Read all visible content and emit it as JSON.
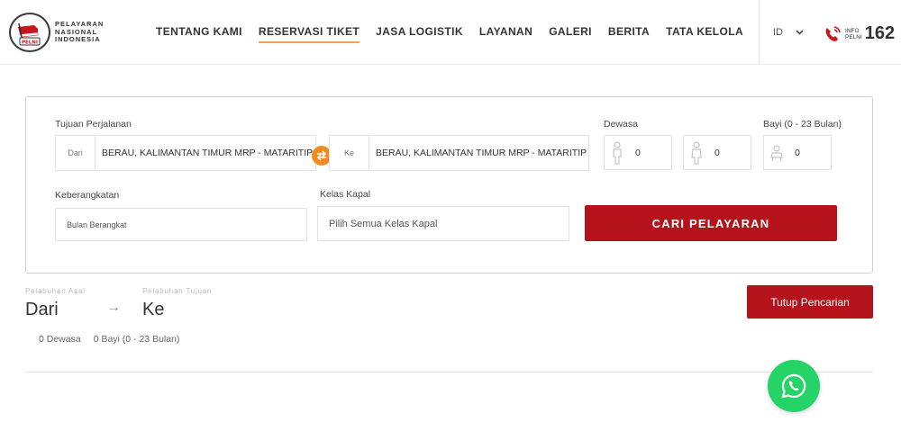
{
  "brand": {
    "lines": [
      "PELAYARAN",
      "NASIONAL",
      "INDONESIA"
    ],
    "badge_text": "PELNI"
  },
  "nav": [
    {
      "label": "TENTANG KAMI",
      "active": false
    },
    {
      "label": "RESERVASI TIKET",
      "active": true
    },
    {
      "label": "JASA LOGISTIK",
      "active": false
    },
    {
      "label": "LAYANAN",
      "active": false
    },
    {
      "label": "GALERI",
      "active": false
    },
    {
      "label": "BERITA",
      "active": false
    },
    {
      "label": "TATA KELOLA",
      "active": false
    }
  ],
  "header_right": {
    "language": "ID",
    "info_label_top": "INFO",
    "info_label_bottom": "PELNI",
    "info_number": "162"
  },
  "search": {
    "destination_label": "Tujuan Perjalanan",
    "from_prefix": "Dari",
    "from_value": "BERAU, KALIMANTAN TIMUR MRP - MATARITIP",
    "to_prefix": "Ke",
    "to_value": "BERAU, KALIMANTAN TIMUR MRP - MATARITIP",
    "adult_label": "Dewasa",
    "adult_value": "0",
    "second_pax_value": "0",
    "infant_label": "Bayi (0 - 23 Bulan)",
    "infant_value": "0",
    "departure_label": "Keberangkatan",
    "departure_placeholder": "Bulan Berangkat",
    "class_label": "Kelas Kapal",
    "class_placeholder": "Pilih Semua Kelas Kapal",
    "search_button": "CARI PELAYARAN"
  },
  "summary": {
    "origin_label": "Pelabuhan Asal",
    "origin_value": "Dari",
    "destination_label": "Pelabuhan Tujuan",
    "destination_value": "Ke",
    "arrow": "→",
    "adults": "0 Dewasa",
    "infants": "0 Bayi (0 - 23 Bulan)",
    "close_button": "Tutup Pencarian"
  },
  "colors": {
    "primary": "#b5121b",
    "accent": "#f28a22",
    "whatsapp": "#25d366"
  },
  "icons": [
    "pelni-logo-icon",
    "chevron-down-icon",
    "phone-icon",
    "swap-icon",
    "adult-icon",
    "child-icon",
    "infant-icon",
    "whatsapp-icon"
  ]
}
